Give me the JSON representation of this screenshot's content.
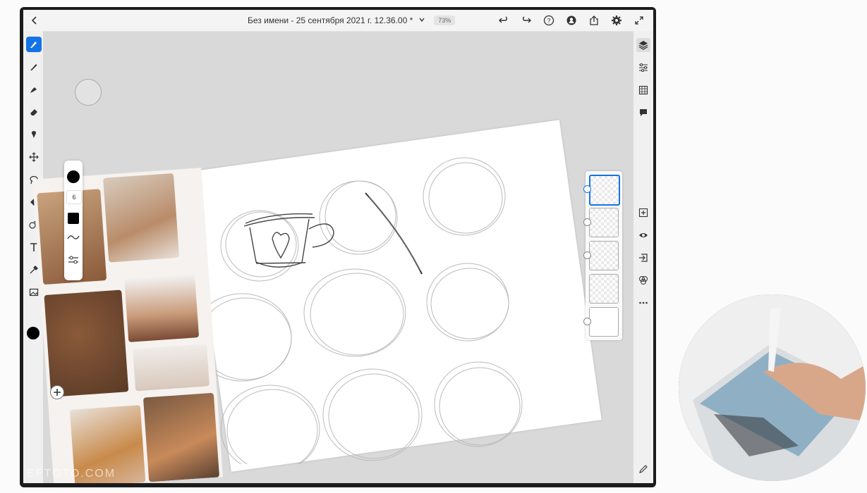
{
  "app": {
    "document_title": "Без имени - 25 сентября 2021 г. 12.36.00 *",
    "zoom": "73%"
  },
  "top_toolbar": {
    "icons": [
      "back-chevron-icon",
      "undo-icon",
      "redo-icon",
      "help-icon",
      "invite-user-icon",
      "share-icon",
      "settings-gear-icon",
      "fullscreen-icon"
    ]
  },
  "left_tools": {
    "items": [
      "pixel-brush-icon",
      "live-brush-icon",
      "vector-brush-icon",
      "eraser-icon",
      "smudge-icon",
      "transform-icon",
      "lasso-icon",
      "fill-icon",
      "shapes-icon",
      "text-icon",
      "eyedropper-icon",
      "image-icon"
    ],
    "active": "pixel-brush-icon",
    "current_color": "#000000"
  },
  "brush_popup": {
    "size_value": "6"
  },
  "right_rail": {
    "items": [
      "layers-icon",
      "adjustments-icon",
      "grid-icon",
      "comments-icon",
      "add-layer-icon",
      "visibility-icon",
      "import-icon",
      "blend-icon",
      "more-icon",
      "pencil-icon"
    ]
  },
  "layers_panel": {
    "count": 5,
    "selected_index": 0
  },
  "colors": {
    "accent": "#1473e6",
    "canvas_bg": "#d9d9d9",
    "toolbar_bg": "#f4f4f4"
  },
  "watermark": {
    "text": "EFTOTO.COM"
  }
}
